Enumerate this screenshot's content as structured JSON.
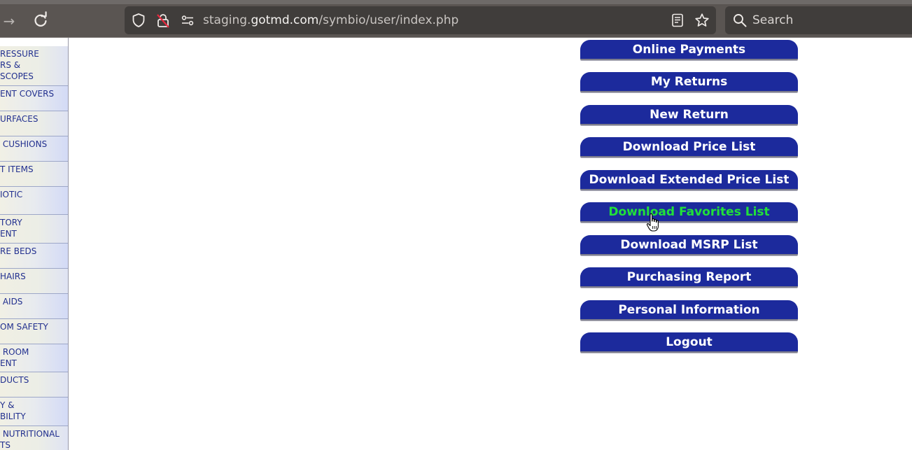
{
  "browser": {
    "url_prefix": "staging.",
    "url_domain": "gotmd.com",
    "url_path": "/symbio/user/index.php",
    "search_placeholder": "Search"
  },
  "sidebar": {
    "categories": [
      {
        "lines": [
          "RESSURE",
          "RS &",
          "SCOPES"
        ]
      },
      {
        "lines": [
          "ENT COVERS"
        ]
      },
      {
        "lines": [
          "URFACES"
        ]
      },
      {
        "lines": [
          " CUSHIONS"
        ]
      },
      {
        "lines": [
          "T ITEMS"
        ]
      },
      {
        "lines": [
          "IOTIC"
        ]
      },
      {
        "lines": [
          "TORY",
          "ENT"
        ]
      },
      {
        "lines": [
          "RE BEDS"
        ]
      },
      {
        "lines": [
          "HAIRS"
        ]
      },
      {
        "lines": [
          " AIDS"
        ]
      },
      {
        "lines": [
          "OM SAFETY"
        ]
      },
      {
        "lines": [
          " ROOM",
          "ENT"
        ]
      },
      {
        "lines": [
          "DUCTS"
        ]
      },
      {
        "lines": [
          "Y &",
          "BILITY"
        ]
      },
      {
        "lines": [
          " NUTRITIONAL",
          "TS"
        ]
      }
    ]
  },
  "account_menu": {
    "buttons": [
      {
        "label": "Online Payments",
        "state": "normal"
      },
      {
        "label": "My Returns",
        "state": "normal"
      },
      {
        "label": "New Return",
        "state": "normal"
      },
      {
        "label": "Download Price List",
        "state": "normal"
      },
      {
        "label": "Download Extended Price List",
        "state": "normal"
      },
      {
        "label": "Download Favorites List",
        "state": "hover"
      },
      {
        "label": "Download MSRP List",
        "state": "normal"
      },
      {
        "label": "Purchasing Report",
        "state": "normal"
      },
      {
        "label": "Personal Information",
        "state": "normal"
      },
      {
        "label": "Logout",
        "state": "normal"
      }
    ]
  },
  "colors": {
    "button_bg": "#1c2a9c",
    "button_text": "#ffffff",
    "button_hover_text": "#21e03a",
    "category_text": "#22308f"
  },
  "icons": {
    "forward": "forward-arrow-icon",
    "reload": "reload-icon",
    "shield": "tracking-shield-icon",
    "lock": "insecure-lock-icon",
    "permissions": "site-permissions-icon",
    "reader": "reader-view-icon",
    "bookmark": "bookmark-star-icon",
    "search": "search-icon",
    "cursor": "hand-pointer-icon"
  }
}
